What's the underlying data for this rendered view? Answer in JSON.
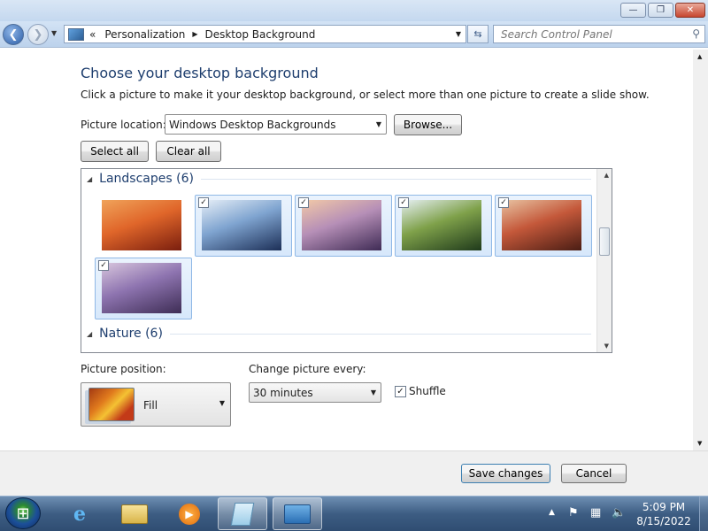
{
  "window": {
    "min_glyph": "—",
    "max_glyph": "❐",
    "close_glyph": "✕"
  },
  "addressbar": {
    "breadcrumb_prefix": "«",
    "crumbs": [
      "Personalization",
      "Desktop Background"
    ],
    "search_placeholder": "Search Control Panel"
  },
  "content": {
    "heading": "Choose your desktop background",
    "description": "Click a picture to make it your desktop background, or select more than one picture to create a slide show.",
    "picture_location_label": "Picture location:",
    "picture_location_value": "Windows Desktop Backgrounds",
    "browse_label": "Browse...",
    "select_all_label": "Select all",
    "clear_all_label": "Clear all"
  },
  "gallery": {
    "groups": [
      {
        "label": "Landscapes (6)"
      },
      {
        "label": "Nature (6)"
      }
    ],
    "thumbnails": [
      {
        "name": "landscape-red-canyon",
        "checked": false,
        "colors": [
          "#7a1e0e",
          "#e0662a",
          "#f0a35a"
        ]
      },
      {
        "name": "landscape-ice-mountain",
        "checked": true,
        "colors": [
          "#1c2f57",
          "#7fa4d0",
          "#e6eef7"
        ]
      },
      {
        "name": "landscape-purple-shore",
        "checked": true,
        "colors": [
          "#3f2b55",
          "#b68fb7",
          "#f2c9a7"
        ]
      },
      {
        "name": "landscape-waterfall",
        "checked": true,
        "colors": [
          "#1f3a1b",
          "#7fa14a",
          "#e6f0f3"
        ]
      },
      {
        "name": "landscape-stone-arch",
        "checked": true,
        "colors": [
          "#4a1d14",
          "#c4583a",
          "#e8c3a2"
        ]
      },
      {
        "name": "landscape-lavender-field",
        "checked": true,
        "colors": [
          "#3e2d55",
          "#8e74b0",
          "#d8c6dd"
        ]
      }
    ],
    "check_glyph": "✓"
  },
  "settings": {
    "position_label": "Picture position:",
    "position_value": "Fill",
    "interval_label": "Change picture every:",
    "interval_value": "30 minutes",
    "shuffle_label": "Shuffle",
    "shuffle_checked": true
  },
  "footer": {
    "save_label": "Save changes",
    "cancel_label": "Cancel"
  },
  "taskbar": {
    "time": "5:09 PM",
    "date": "8/15/2022",
    "items": [
      "internet-explorer-icon",
      "file-explorer-icon",
      "media-player-icon",
      "notepad-icon",
      "control-panel-icon"
    ]
  }
}
